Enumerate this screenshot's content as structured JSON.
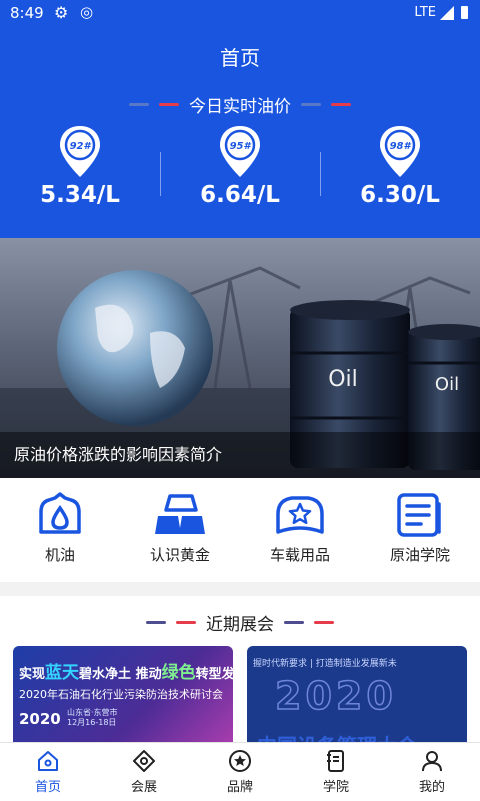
{
  "status_bar": {
    "time": "8:49",
    "network": "LTE"
  },
  "header": {
    "title": "首页",
    "oil_section_title": "今日实时油价",
    "prices": [
      {
        "grade": "92#",
        "price": "5.34/L"
      },
      {
        "grade": "95#",
        "price": "6.64/L"
      },
      {
        "grade": "98#",
        "price": "6.30/L"
      }
    ]
  },
  "banner": {
    "caption": "原油价格涨跌的影响因素简介",
    "barrel_text": "Oil"
  },
  "grid": {
    "items": [
      {
        "label": "机油",
        "icon": "oil-drop-icon"
      },
      {
        "label": "认识黄金",
        "icon": "gold-bars-icon"
      },
      {
        "label": "车载用品",
        "icon": "car-star-icon"
      },
      {
        "label": "原油学院",
        "icon": "document-icon"
      }
    ]
  },
  "expo": {
    "title": "近期展会",
    "card_a": {
      "w1": "实现",
      "w2": "蓝天",
      "w3": "碧水净土",
      "w4": "推动",
      "w5": "绿色",
      "w6": "转型发展",
      "subtitle": "2020年石油石化行业污染防治技术研讨会",
      "year": "2020",
      "place": "山东省·东营市",
      "dates": "12月16-18日"
    },
    "card_b": {
      "slogan": "握时代新要求 | 打造制造业发展新未",
      "year": "2020",
      "title": "中国设备管理大会"
    }
  },
  "tabbar": {
    "tabs": [
      {
        "label": "首页",
        "icon": "home-icon",
        "active": true
      },
      {
        "label": "会展",
        "icon": "expo-icon"
      },
      {
        "label": "品牌",
        "icon": "brand-star-icon"
      },
      {
        "label": "学院",
        "icon": "book-icon"
      },
      {
        "label": "我的",
        "icon": "user-icon"
      }
    ]
  },
  "colors": {
    "primary": "#1a55e0",
    "accent_red": "#e53b4a"
  }
}
